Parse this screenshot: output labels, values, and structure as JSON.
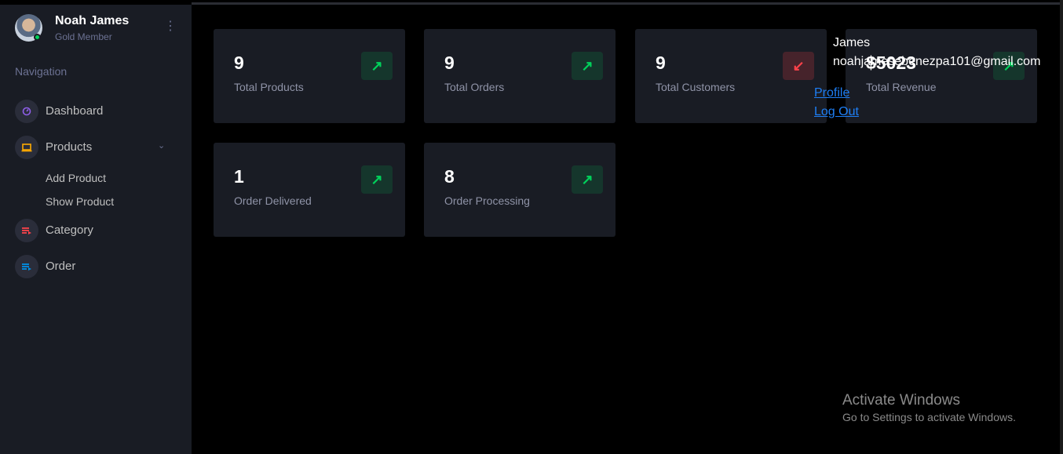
{
  "user": {
    "name": "Noah James",
    "role": "Gold Member"
  },
  "sidebar": {
    "section_title": "Navigation",
    "items": [
      {
        "label": "Dashboard",
        "icon": "speedometer-icon",
        "icon_color": "#8f5fe8"
      },
      {
        "label": "Products",
        "icon": "laptop-icon",
        "icon_color": "#ffab00"
      },
      {
        "label": "Category",
        "icon": "playlist-icon",
        "icon_color": "#fc424a"
      },
      {
        "label": "Order",
        "icon": "list-icon",
        "icon_color": "#0090e7"
      }
    ],
    "sub_items": [
      {
        "label": "Add Product"
      },
      {
        "label": "Show Product"
      }
    ]
  },
  "cards": [
    {
      "value": "9",
      "label": "Total Products",
      "trend": "up"
    },
    {
      "value": "9",
      "label": "Total Orders",
      "trend": "up"
    },
    {
      "value": "9",
      "label": "Total Customers",
      "trend": "down"
    },
    {
      "value": "$5023",
      "label": "Total Revenue",
      "trend": "up"
    },
    {
      "value": "1",
      "label": "Order Delivered",
      "trend": "up"
    },
    {
      "value": "8",
      "label": "Order Processing",
      "trend": "up"
    }
  ],
  "profile_menu": {
    "name": "James",
    "email": "noahjamesebenezpa101@gmail.com",
    "profile_link": "Profile",
    "logout_link": "Log Out"
  },
  "watermark": {
    "title": "Activate Windows",
    "subtitle": "Go to Settings to activate Windows."
  },
  "colors": {
    "accent_up": "#00d25b",
    "accent_down": "#fc424a",
    "link": "#1e7ff5",
    "sidebar_bg": "#191c24"
  }
}
